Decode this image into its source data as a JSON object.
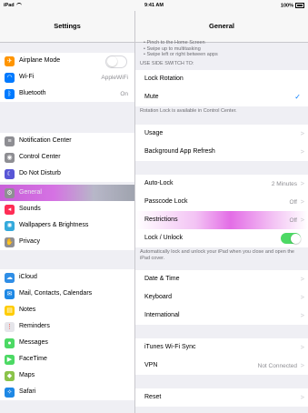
{
  "status_bar": {
    "device": "iPad",
    "time": "9:41 AM",
    "battery": "100%"
  },
  "left": {
    "title": "Settings",
    "groups": [
      [
        {
          "label": "Airplane Mode",
          "icon": "airplane-icon",
          "glyph": "✈",
          "color": "#ff9500",
          "control": "toggle-off"
        },
        {
          "label": "Wi-Fi",
          "icon": "wifi-icon",
          "glyph": "◠",
          "color": "#007aff",
          "value": "AppleWiFi"
        },
        {
          "label": "Bluetooth",
          "icon": "bluetooth-icon",
          "glyph": "ᛒ",
          "color": "#007aff",
          "value": "On"
        }
      ],
      [
        {
          "label": "Notification Center",
          "icon": "notification-center-icon",
          "glyph": "≡",
          "color": "#8e8e93"
        },
        {
          "label": "Control Center",
          "icon": "control-center-icon",
          "glyph": "◉",
          "color": "#8e8e93"
        },
        {
          "label": "Do Not Disturb",
          "icon": "moon-icon",
          "glyph": "☾",
          "color": "#5856d6"
        }
      ],
      [
        {
          "label": "General",
          "icon": "gear-icon",
          "glyph": "⚙",
          "color": "#8e8e93",
          "selected": true
        },
        {
          "label": "Sounds",
          "icon": "speaker-icon",
          "glyph": "◂",
          "color": "#ff2d55"
        },
        {
          "label": "Wallpapers & Brightness",
          "icon": "brightness-icon",
          "glyph": "✺",
          "color": "#34aadc"
        },
        {
          "label": "Privacy",
          "icon": "hand-icon",
          "glyph": "✋",
          "color": "#8e8e93"
        }
      ],
      [
        {
          "label": "iCloud",
          "icon": "cloud-icon",
          "glyph": "☁",
          "color": "#2f8ee6"
        },
        {
          "label": "Mail, Contacts, Calendars",
          "icon": "mail-icon",
          "glyph": "✉",
          "color": "#1e88e5"
        },
        {
          "label": "Notes",
          "icon": "notes-icon",
          "glyph": "▤",
          "color": "#ffcc00"
        },
        {
          "label": "Reminders",
          "icon": "reminders-icon",
          "glyph": "⋮",
          "color": "#e5e5ea"
        },
        {
          "label": "Messages",
          "icon": "messages-icon",
          "glyph": "●",
          "color": "#4cd964"
        },
        {
          "label": "FaceTime",
          "icon": "facetime-icon",
          "glyph": "▶",
          "color": "#4cd964"
        },
        {
          "label": "Maps",
          "icon": "maps-icon",
          "glyph": "◆",
          "color": "#8bc34a"
        },
        {
          "label": "Safari",
          "icon": "safari-icon",
          "glyph": "✧",
          "color": "#1e88e5"
        }
      ]
    ]
  },
  "right": {
    "title": "General",
    "hint_lines": [
      "• Pinch to the Home Screen",
      "• Swipe up to multitasking",
      "• Swipe left or right between apps"
    ],
    "side_switch_header": "USE SIDE SWITCH TO:",
    "side_switch": [
      {
        "label": "Lock Rotation"
      },
      {
        "label": "Mute",
        "checked": true
      }
    ],
    "rotation_footer": "Rotation Lock is available in Control Center.",
    "group1": [
      {
        "label": "Usage"
      },
      {
        "label": "Background App Refresh"
      }
    ],
    "group2": [
      {
        "label": "Auto-Lock",
        "value": "2 Minutes"
      },
      {
        "label": "Passcode Lock",
        "value": "Off"
      },
      {
        "label": "Restrictions",
        "value": "Off",
        "highlight": true
      },
      {
        "label": "Lock / Unlock",
        "control": "toggle-on"
      }
    ],
    "lock_footer": "Automatically lock and unlock your iPad when you close and open the iPad cover.",
    "group3": [
      {
        "label": "Date & Time"
      },
      {
        "label": "Keyboard"
      },
      {
        "label": "International"
      }
    ],
    "group4": [
      {
        "label": "iTunes Wi-Fi Sync"
      },
      {
        "label": "VPN",
        "value": "Not Connected"
      }
    ],
    "group5": [
      {
        "label": "Reset"
      }
    ],
    "chevron": ">",
    "checkmark": "✓"
  }
}
